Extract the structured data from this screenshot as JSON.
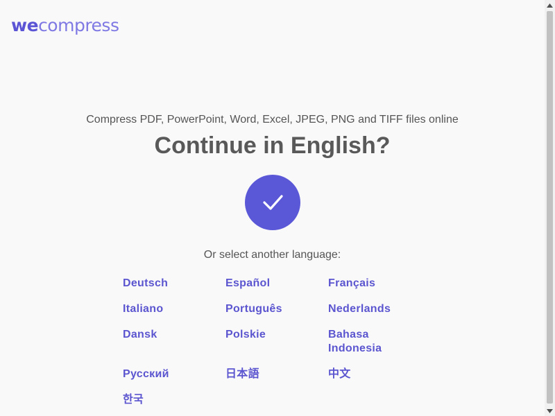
{
  "logo": {
    "part1": "we",
    "part2": "compress"
  },
  "tagline": "Compress PDF, PowerPoint, Word, Excel, JPEG, PNG and TIFF files online",
  "headline": "Continue in English?",
  "confirm_icon": "check-icon",
  "or_select": "Or select another language:",
  "languages": [
    {
      "label": "Deutsch"
    },
    {
      "label": "Español"
    },
    {
      "label": "Français"
    },
    {
      "label": "Italiano"
    },
    {
      "label": "Português"
    },
    {
      "label": "Nederlands"
    },
    {
      "label": "Dansk"
    },
    {
      "label": "Polskie"
    },
    {
      "label": "Bahasa Indonesia"
    },
    {
      "label": "Русский"
    },
    {
      "label": "日本語"
    },
    {
      "label": "中文"
    },
    {
      "label": "한국"
    }
  ],
  "colors": {
    "accent": "#5b58d8",
    "link": "#5b55cf",
    "background": "#f9f9fa",
    "text": "#555555"
  }
}
